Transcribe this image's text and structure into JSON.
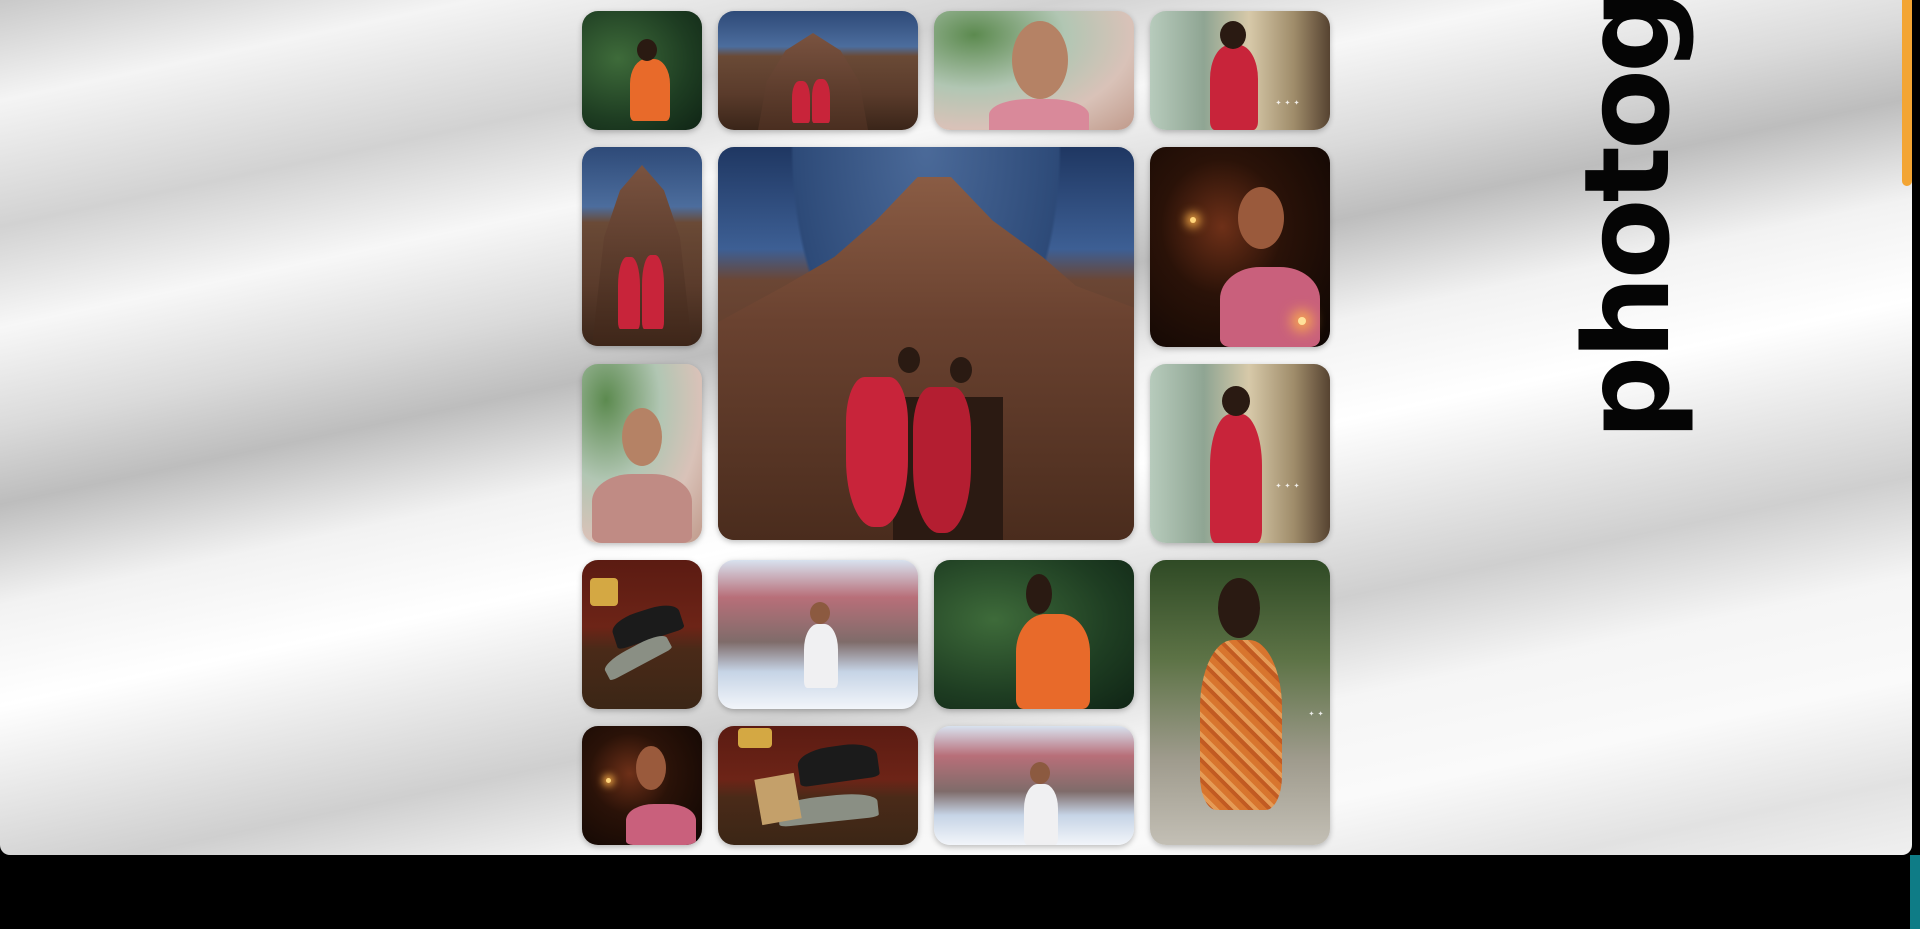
{
  "heading": {
    "vertical_text": "photogr"
  },
  "gallery": {
    "tiles": [
      {
        "alt": "Woman in orange dress in forest"
      },
      {
        "alt": "Dancers at ancient stone temple"
      },
      {
        "alt": "Smiling woman among pink flowers"
      },
      {
        "alt": "Woman in red outfit seated on porch"
      },
      {
        "alt": "Dancers at stone temple, portrait"
      },
      {
        "alt": "Odissi dancers posing in front of stone temple"
      },
      {
        "alt": "Woman holding fairy lights in dark"
      },
      {
        "alt": "Smiling woman in pink sweater with flowers"
      },
      {
        "alt": "Woman in red outfit seated on porch"
      },
      {
        "alt": "Man lying on wooden floor near sofa"
      },
      {
        "alt": "Man in white shirt in snowy village"
      },
      {
        "alt": "Woman in orange dress looking up in forest"
      },
      {
        "alt": "Woman in floral orange dress on street"
      },
      {
        "alt": "Woman holding fairy lights"
      },
      {
        "alt": "Man lying near sofa holding book"
      },
      {
        "alt": "Man in white shirt in snowy village"
      }
    ]
  },
  "colors": {
    "scroll_thumb": "#f3a534",
    "bottom_accent": "#0e7c86"
  }
}
